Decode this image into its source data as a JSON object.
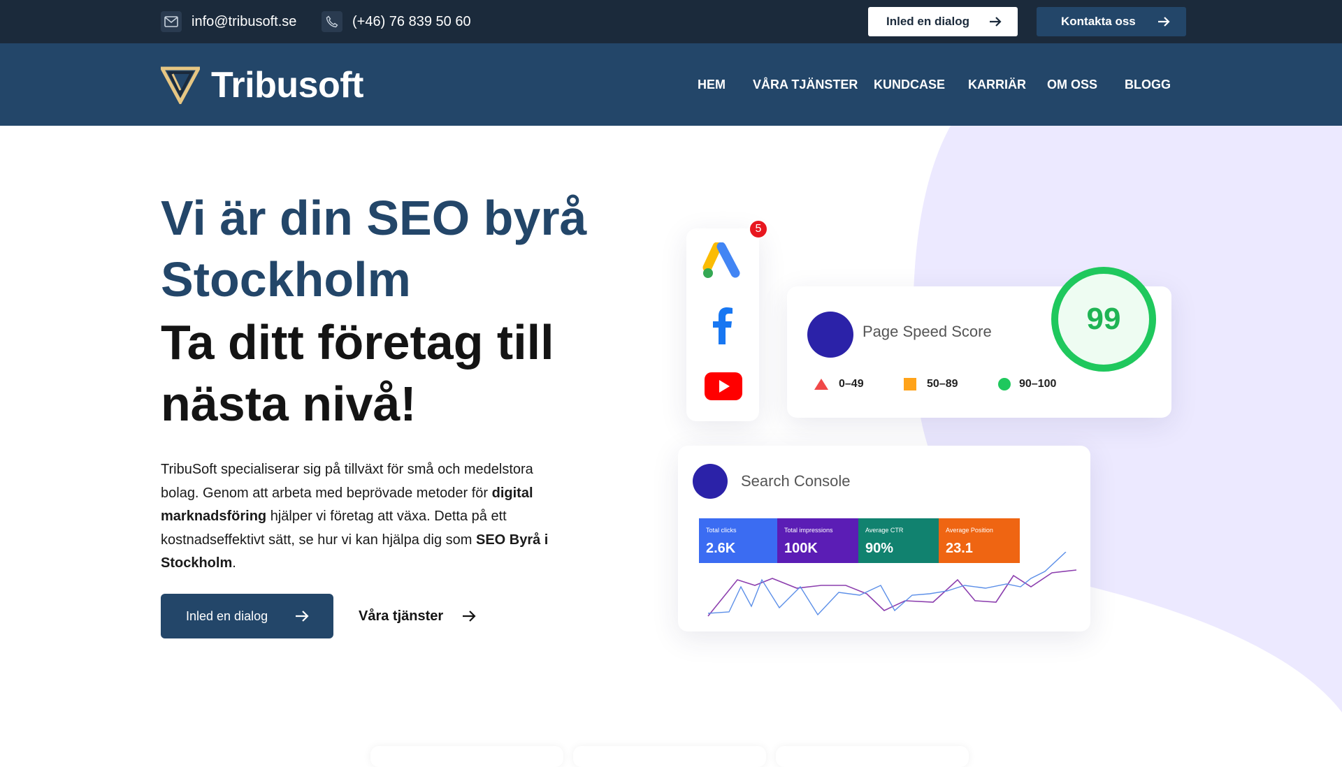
{
  "topbar": {
    "email": "info@tribusoft.se",
    "phone": "(+46) 76 839 50 60",
    "btn_dialog": "Inled en dialog",
    "btn_contact": "Kontakta oss"
  },
  "brand": {
    "name": "Tribusoft"
  },
  "nav": [
    "HEM",
    "VÅRA TJÄNSTER",
    "KUNDCASE",
    "KARRIÄR",
    "OM OSS",
    "BLOGG"
  ],
  "hero": {
    "title_line1": "Vi är din SEO byrå",
    "title_line2": "Stockholm",
    "title_line3": "Ta ditt företag till nästa nivå!",
    "desc_1": "TribuSoft specialiserar sig på tillväxt för små och medelstora bolag. Genom att arbeta med beprövade metoder för ",
    "desc_bold_1": "digital marknadsföring",
    "desc_2": " hjälper vi företag att växa. Detta på ett kostnadseffektivt sätt, se hur vi kan hjälpa dig som ",
    "desc_bold_2": "SEO Byrå i Stockholm",
    "desc_3": ".",
    "cta_primary": "Inled en dialog",
    "cta_secondary": "Våra tjänster"
  },
  "social_card": {
    "badge_count": "5",
    "icons": [
      "google-ads-icon",
      "facebook-icon",
      "youtube-icon"
    ]
  },
  "page_speed": {
    "title": "Page Speed Score",
    "score": "99",
    "legend": [
      {
        "label": "0–49",
        "color": "#f04848"
      },
      {
        "label": "50–89",
        "color": "#ffa31a"
      },
      {
        "label": "90–100",
        "color": "#1fc85d"
      }
    ]
  },
  "search_console": {
    "title": "Search Console",
    "metrics": [
      {
        "label": "Total clicks",
        "value": "2.6K",
        "color": "#3b6cf2"
      },
      {
        "label": "Total impressions",
        "value": "100K",
        "color": "#5b1db5"
      },
      {
        "label": "Average CTR",
        "value": "90%",
        "color": "#11826f"
      },
      {
        "label": "Average Position",
        "value": "23.1",
        "color": "#ef6512"
      }
    ]
  },
  "colors": {
    "dark": "#1b2a3b",
    "navy": "#234669",
    "lavender": "#ece9ff",
    "accent_circle": "#2b22a8"
  }
}
